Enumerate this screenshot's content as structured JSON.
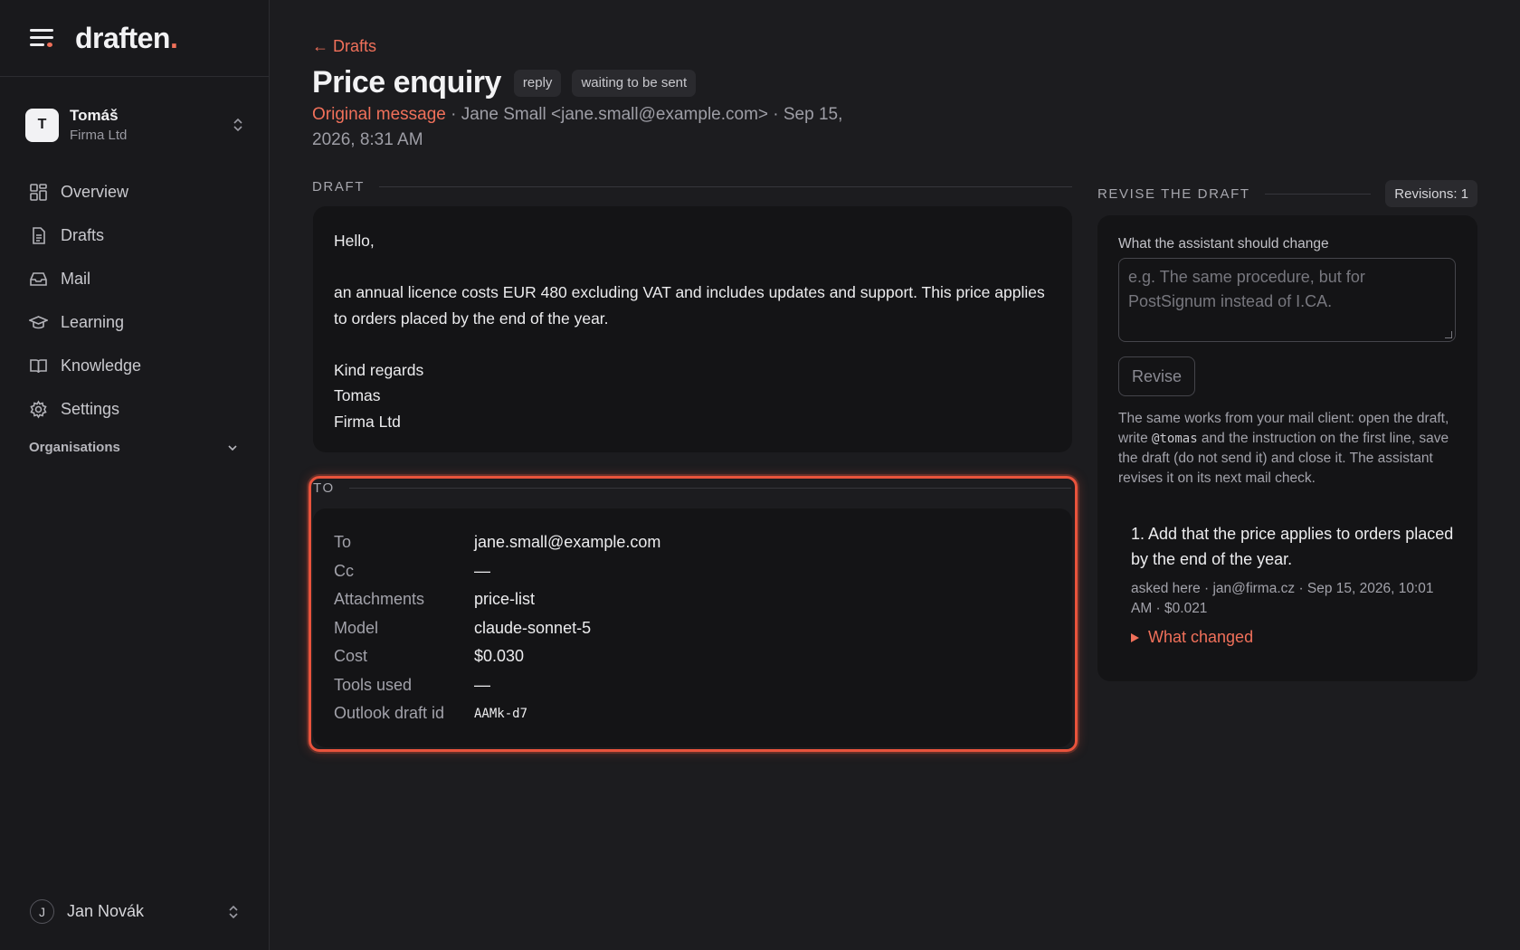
{
  "app": {
    "logo_text": "draften",
    "logo_dot": "."
  },
  "org": {
    "initial": "T",
    "name": "Tomáš",
    "company": "Firma Ltd"
  },
  "nav": [
    {
      "label": "Overview",
      "icon": "grid-icon"
    },
    {
      "label": "Drafts",
      "icon": "document-icon"
    },
    {
      "label": "Mail",
      "icon": "inbox-icon"
    },
    {
      "label": "Learning",
      "icon": "graduation-cap-icon"
    },
    {
      "label": "Knowledge",
      "icon": "book-icon"
    },
    {
      "label": "Settings",
      "icon": "gear-icon"
    }
  ],
  "organisations_label": "Organisations",
  "user": {
    "initial": "J",
    "name": "Jan Novák"
  },
  "header": {
    "back_label": "← Drafts",
    "title": "Price enquiry",
    "chips": [
      "reply",
      "waiting to be sent"
    ],
    "original_link": "Original message",
    "meta_text": " · Jane Small <jane.small@example.com> · Sep 15, 2026, 8:31 AM"
  },
  "draft": {
    "section_label": "DRAFT",
    "greeting": "Hello,",
    "body": "an annual licence costs EUR 480 excluding VAT and includes updates and support. This price applies to orders placed by the end of the year.",
    "closing": "Kind regards",
    "sign_name": "Tomas",
    "sign_company": "Firma Ltd"
  },
  "details": {
    "section_label": "TO",
    "rows": [
      {
        "key": "To",
        "value": "jane.small@example.com"
      },
      {
        "key": "Cc",
        "value": "—"
      },
      {
        "key": "Attachments",
        "value": "price-list"
      },
      {
        "key": "Model",
        "value": "claude-sonnet-5"
      },
      {
        "key": "Cost",
        "value": "$0.030"
      },
      {
        "key": "Tools used",
        "value": "—"
      },
      {
        "key": "Outlook draft id",
        "value": "AAMk-d7"
      }
    ]
  },
  "revise": {
    "section_label": "REVISE THE DRAFT",
    "count_label": "Revisions: 1",
    "field_label": "What the assistant should change",
    "placeholder": "e.g. The same procedure, but for PostSignum instead of I.CA.",
    "button_label": "Revise",
    "help_before": "The same works from your mail client: open the draft, write ",
    "help_code": "@tomas",
    "help_after": " and the instruction on the first line, save the draft (do not send it) and close it. The assistant revises it on its next mail check.",
    "revisions": [
      {
        "text": "1. Add that the price applies to orders placed by the end of the year.",
        "info": "asked here · jan@firma.cz · Sep 15, 2026, 10:01 AM · $0.021",
        "toggle_label": "What changed"
      }
    ]
  }
}
